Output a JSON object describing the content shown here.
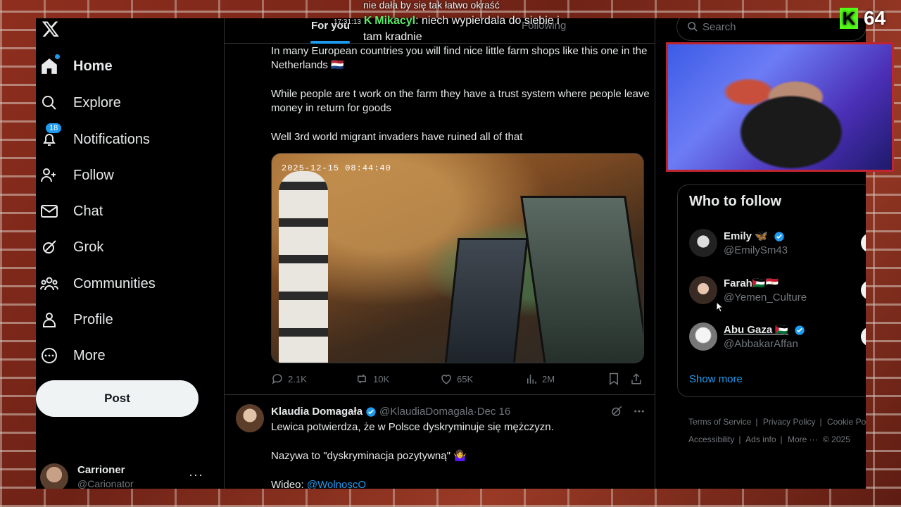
{
  "nav": {
    "items": [
      {
        "label": "Home",
        "icon": "home-icon"
      },
      {
        "label": "Explore",
        "icon": "search-icon"
      },
      {
        "label": "Notifications",
        "icon": "bell-icon",
        "badge": "18"
      },
      {
        "label": "Follow",
        "icon": "add-person-icon"
      },
      {
        "label": "Chat",
        "icon": "envelope-icon"
      },
      {
        "label": "Grok",
        "icon": "grok-icon"
      },
      {
        "label": "Communities",
        "icon": "communities-icon"
      },
      {
        "label": "Profile",
        "icon": "person-icon"
      },
      {
        "label": "More",
        "icon": "more-circle-icon"
      }
    ],
    "post_label": "Post",
    "account": {
      "name": "Carrioner",
      "handle": "@Carionator"
    }
  },
  "tabs": {
    "for_you": "For you",
    "following": "Following"
  },
  "tweet1": {
    "line1": "In many European countries you will find nice little farm shops like this one in the Netherlands 🇳🇱",
    "line2": "While people are t work on the farm they have a trust system where people leave money in return for goods",
    "line3": "Well 3rd world migrant invaders have ruined all of that",
    "media_timestamp": "2025-12-15 08:44:40",
    "stats": {
      "replies": "2.1K",
      "reposts": "10K",
      "likes": "65K",
      "views": "2M"
    }
  },
  "tweet2": {
    "name": "Klaudia Domagała",
    "handle": "@KlaudiaDomagala",
    "sep": " · ",
    "date": "Dec 16",
    "line1": "Lewica potwierdza, że w Polsce dyskryminuje się mężczyzn.",
    "line2": "Nazywa to \"dyskryminacja pozytywną\" 🤷‍♀️",
    "line3_prefix": "Wideo: ",
    "line3_link": "@WolnoscO"
  },
  "search": {
    "placeholder": "Search"
  },
  "who_to_follow": {
    "title": "Who to follow",
    "people": [
      {
        "name": "Emily 🦋",
        "handle": "@EmilySm43",
        "verified": true
      },
      {
        "name": "Farah🇵🇸🇪🇬",
        "handle": "@Yemen_Culture",
        "verified": false
      },
      {
        "name": "Abu Gaza 🇵🇸",
        "handle": "@AbbakarAffan",
        "verified": true
      }
    ],
    "show_more": "Show more"
  },
  "footer": {
    "terms": "Terms of Service",
    "privacy": "Privacy Policy",
    "cookie": "Cookie Po",
    "accessibility": "Accessibility",
    "ads": "Ads info",
    "more": "More ···",
    "copyright": "© 2025"
  },
  "stream_overlay": {
    "chat_top": "nie dała by się tak łatwo okraść",
    "chat_time": "17:31:13",
    "chat_user": "Mikacyl",
    "chat_text": ": niech wypierdala do siebie i",
    "chat_text2": "tam kradnie",
    "viewer_count": "64"
  },
  "colors": {
    "accent": "#1d9bf0",
    "background": "#000000",
    "kick_green": "#53fc18",
    "webcam_border": "#c0242f"
  }
}
